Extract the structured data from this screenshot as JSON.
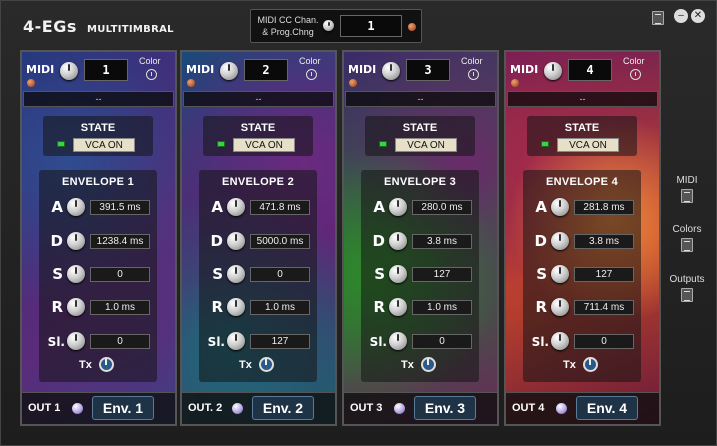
{
  "app": {
    "title": "4-EGs",
    "subtitle": "MULTITIMBRAL"
  },
  "midi_cc": {
    "label_line1": "MIDI CC Chan.",
    "label_line2": "& Prog.Chng",
    "value": "1"
  },
  "side_panel": {
    "midi_label": "MIDI",
    "colors_label": "Colors",
    "outputs_label": "Outputs"
  },
  "channels": [
    {
      "midi_label": "MIDI",
      "midi_value": "1",
      "color_label": "Color",
      "name": "--",
      "state_label": "STATE",
      "state_value": "VCA ON",
      "envelope_title": "ENVELOPE 1",
      "params": [
        {
          "label": "A",
          "value": "391.5 ms"
        },
        {
          "label": "D",
          "value": "1238.4 ms"
        },
        {
          "label": "S",
          "value": "0"
        },
        {
          "label": "R",
          "value": "1.0 ms"
        },
        {
          "label": "Sl.",
          "value": "0"
        }
      ],
      "tx_label": "Tx",
      "out_label": "OUT 1",
      "env_button": "Env. 1"
    },
    {
      "midi_label": "MIDI",
      "midi_value": "2",
      "color_label": "Color",
      "name": "--",
      "state_label": "STATE",
      "state_value": "VCA ON",
      "envelope_title": "ENVELOPE 2",
      "params": [
        {
          "label": "A",
          "value": "471.8 ms"
        },
        {
          "label": "D",
          "value": "5000.0 ms"
        },
        {
          "label": "S",
          "value": "0"
        },
        {
          "label": "R",
          "value": "1.0 ms"
        },
        {
          "label": "Sl.",
          "value": "127"
        }
      ],
      "tx_label": "Tx",
      "out_label": "OUT. 2",
      "env_button": "Env. 2"
    },
    {
      "midi_label": "MIDI",
      "midi_value": "3",
      "color_label": "Color",
      "name": "--",
      "state_label": "STATE",
      "state_value": "VCA ON",
      "envelope_title": "ENVELOPE 3",
      "params": [
        {
          "label": "A",
          "value": "280.0 ms"
        },
        {
          "label": "D",
          "value": "3.8 ms"
        },
        {
          "label": "S",
          "value": "127"
        },
        {
          "label": "R",
          "value": "1.0 ms"
        },
        {
          "label": "Sl.",
          "value": "0"
        }
      ],
      "tx_label": "Tx",
      "out_label": "OUT 3",
      "env_button": "Env. 3"
    },
    {
      "midi_label": "MIDI",
      "midi_value": "4",
      "color_label": "Color",
      "name": "--",
      "state_label": "STATE",
      "state_value": "VCA ON",
      "envelope_title": "ENVELOPE 4",
      "params": [
        {
          "label": "A",
          "value": "281.8 ms"
        },
        {
          "label": "D",
          "value": "3.8 ms"
        },
        {
          "label": "S",
          "value": "127"
        },
        {
          "label": "R",
          "value": "711.4 ms"
        },
        {
          "label": "Sl.",
          "value": "0"
        }
      ],
      "tx_label": "Tx",
      "out_label": "OUT 4",
      "env_button": "Env. 4"
    }
  ]
}
